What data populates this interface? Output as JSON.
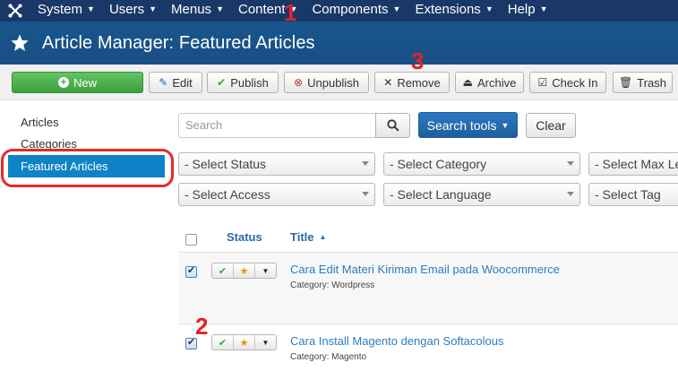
{
  "topbar": {
    "logo_icon": "joomla-logo-icon",
    "menu": [
      {
        "label": "System"
      },
      {
        "label": "Users"
      },
      {
        "label": "Menus"
      },
      {
        "label": "Content"
      },
      {
        "label": "Components"
      },
      {
        "label": "Extensions"
      },
      {
        "label": "Help"
      }
    ]
  },
  "header": {
    "icon": "star-icon",
    "title": "Article Manager: Featured Articles"
  },
  "toolbar": {
    "new": "New",
    "edit": "Edit",
    "publish": "Publish",
    "unpublish": "Unpublish",
    "remove": "Remove",
    "archive": "Archive",
    "checkin": "Check In",
    "trash": "Trash"
  },
  "sidebar": {
    "items": [
      {
        "label": "Articles",
        "active": false
      },
      {
        "label": "Categories",
        "active": false
      },
      {
        "label": "Featured Articles",
        "active": true
      }
    ]
  },
  "search": {
    "placeholder": "Search",
    "tools_label": "Search tools",
    "clear_label": "Clear"
  },
  "filters": {
    "status": "- Select Status",
    "category": "- Select Category",
    "max_levels": "- Select Max Levels",
    "access": "- Select Access",
    "language": "- Select Language",
    "tag": "- Select Tag"
  },
  "table": {
    "columns": {
      "status": "Status",
      "title": "Title"
    },
    "rows": [
      {
        "title": "Cara Edit Materi Kiriman Email pada Woocommerce",
        "category": "Category: Wordpress",
        "checked": true
      },
      {
        "title": "Cara Install Magento dengan Softacolous",
        "category": "Category: Magento",
        "checked": true
      }
    ]
  },
  "annotations": {
    "n1": "1",
    "n2": "2",
    "n3": "3"
  },
  "colors": {
    "topbar": "#1a3867",
    "header": "#17568c",
    "active_sidebar": "#0f83c7",
    "new_button": "#46a546",
    "annotation_red": "#e32222",
    "link": "#2a7ec4"
  }
}
